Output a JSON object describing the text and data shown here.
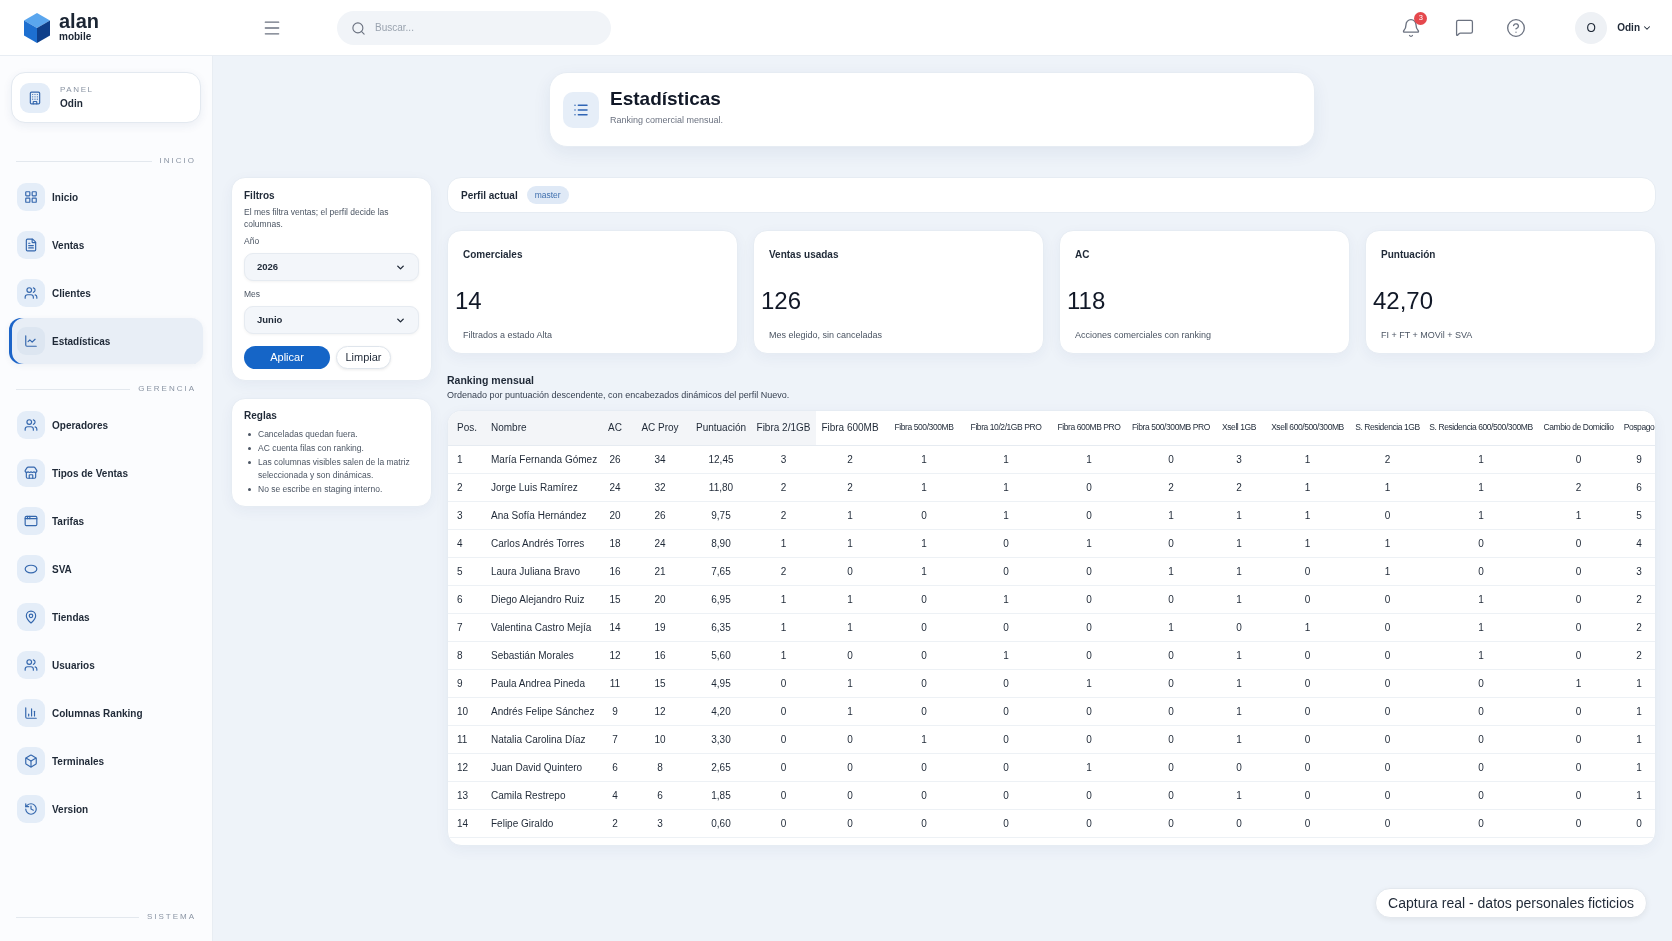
{
  "brand": {
    "name": "alan",
    "tagline": "mobile"
  },
  "search": {
    "placeholder": "Buscar..."
  },
  "notifications": {
    "count": "3"
  },
  "user": {
    "initial": "O",
    "name": "Odin"
  },
  "panel": {
    "label": "PANEL",
    "name": "Odin"
  },
  "sidebar": {
    "sections": [
      {
        "title": "INICIO",
        "items": [
          {
            "label": "Inicio",
            "selected": false
          },
          {
            "label": "Ventas",
            "selected": false
          },
          {
            "label": "Clientes",
            "selected": false
          },
          {
            "label": "Estadísticas",
            "selected": true
          }
        ]
      },
      {
        "title": "GERENCIA",
        "items": [
          {
            "label": "Operadores",
            "selected": false
          },
          {
            "label": "Tipos de Ventas",
            "selected": false
          },
          {
            "label": "Tarifas",
            "selected": false
          },
          {
            "label": "SVA",
            "selected": false
          },
          {
            "label": "Tiendas",
            "selected": false
          },
          {
            "label": "Usuarios",
            "selected": false
          },
          {
            "label": "Columnas Ranking",
            "selected": false
          },
          {
            "label": "Terminales",
            "selected": false
          },
          {
            "label": "Version",
            "selected": false
          }
        ]
      },
      {
        "title": "SISTEMA"
      }
    ]
  },
  "page_header": {
    "title": "Estadísticas",
    "subtitle": "Ranking comercial mensual."
  },
  "filters": {
    "title": "Filtros",
    "description": "El mes filtra ventas; el perfil decide las columnas.",
    "fields": [
      {
        "label": "Año",
        "value": "2026"
      },
      {
        "label": "Mes",
        "value": "Junio"
      }
    ],
    "buttons": [
      {
        "label": "Aplicar",
        "kind": "primary"
      },
      {
        "label": "Limpiar",
        "kind": "secondary"
      }
    ]
  },
  "rules": {
    "title": "Reglas",
    "items": [
      "Canceladas quedan fuera.",
      "AC cuenta filas con ranking.",
      "Las columnas visibles salen de la matriz seleccionada y son dinámicas.",
      "No se escribe en staging interno."
    ]
  },
  "profile": {
    "label": "Perfil actual",
    "badge": "master"
  },
  "stats": [
    {
      "label": "Comerciales",
      "value": "14",
      "note": "Filtrados a estado Alta"
    },
    {
      "label": "Ventas usadas",
      "value": "126",
      "note": "Mes elegido, sin canceladas"
    },
    {
      "label": "AC",
      "value": "118",
      "note": "Acciones comerciales con ranking"
    },
    {
      "label": "Puntuación",
      "value": "42,70",
      "note": "FI + FT + MOVil + SVA"
    }
  ],
  "ranking": {
    "title": "Ranking mensual",
    "subtitle": "Ordenado por puntuación descendente, con encabezados dinámicos del perfil Nuevo.",
    "columns": [
      "Pos.",
      "Nombre",
      "AC",
      "AC Proy",
      "Puntuación",
      "Fibra 2/1GB",
      "Fibra 600MB",
      "Fibra 500/300MB",
      "Fibra 10/2/1GB PRO",
      "Fibra 600MB PRO",
      "Fibra 500/300MB PRO",
      "Xsell 1GB",
      "Xsell 600/500/300MB",
      "S. Residencia 1GB",
      "S. Residencia 600/500/300MB",
      "Cambio de Domicilio",
      "Pospago"
    ],
    "rows": [
      [
        "1",
        "María Fernanda Gómez",
        "26",
        "34",
        "12,45",
        "3",
        "2",
        "1",
        "1",
        "1",
        "0",
        "3",
        "1",
        "2",
        "1",
        "0",
        "9"
      ],
      [
        "2",
        "Jorge Luis Ramírez",
        "24",
        "32",
        "11,80",
        "2",
        "2",
        "1",
        "1",
        "0",
        "2",
        "2",
        "1",
        "1",
        "1",
        "2",
        "6"
      ],
      [
        "3",
        "Ana Sofía Hernández",
        "20",
        "26",
        "9,75",
        "2",
        "1",
        "0",
        "1",
        "0",
        "1",
        "1",
        "1",
        "0",
        "1",
        "1",
        "5"
      ],
      [
        "4",
        "Carlos Andrés Torres",
        "18",
        "24",
        "8,90",
        "1",
        "1",
        "1",
        "0",
        "1",
        "0",
        "1",
        "1",
        "1",
        "0",
        "0",
        "4"
      ],
      [
        "5",
        "Laura Juliana Bravo",
        "16",
        "21",
        "7,65",
        "2",
        "0",
        "1",
        "0",
        "0",
        "1",
        "1",
        "0",
        "1",
        "0",
        "0",
        "3"
      ],
      [
        "6",
        "Diego Alejandro Ruiz",
        "15",
        "20",
        "6,95",
        "1",
        "1",
        "0",
        "1",
        "0",
        "0",
        "1",
        "0",
        "0",
        "1",
        "0",
        "2"
      ],
      [
        "7",
        "Valentina Castro Mejía",
        "14",
        "19",
        "6,35",
        "1",
        "1",
        "0",
        "0",
        "0",
        "1",
        "0",
        "1",
        "0",
        "1",
        "0",
        "2"
      ],
      [
        "8",
        "Sebastián Morales",
        "12",
        "16",
        "5,60",
        "1",
        "0",
        "0",
        "1",
        "0",
        "0",
        "1",
        "0",
        "0",
        "1",
        "0",
        "2"
      ],
      [
        "9",
        "Paula Andrea Pineda",
        "11",
        "15",
        "4,95",
        "0",
        "1",
        "0",
        "0",
        "1",
        "0",
        "1",
        "0",
        "0",
        "0",
        "1",
        "1"
      ],
      [
        "10",
        "Andrés Felipe Sánchez",
        "9",
        "12",
        "4,20",
        "0",
        "1",
        "0",
        "0",
        "0",
        "0",
        "1",
        "0",
        "0",
        "0",
        "0",
        "1"
      ],
      [
        "11",
        "Natalia Carolina Díaz",
        "7",
        "10",
        "3,30",
        "0",
        "0",
        "1",
        "0",
        "0",
        "0",
        "1",
        "0",
        "0",
        "0",
        "0",
        "1"
      ],
      [
        "12",
        "Juan David Quintero",
        "6",
        "8",
        "2,65",
        "0",
        "0",
        "0",
        "0",
        "1",
        "0",
        "0",
        "0",
        "0",
        "0",
        "0",
        "1"
      ],
      [
        "13",
        "Camila Restrepo",
        "4",
        "6",
        "1,85",
        "0",
        "0",
        "0",
        "0",
        "0",
        "0",
        "1",
        "0",
        "0",
        "0",
        "0",
        "1"
      ],
      [
        "14",
        "Felipe Giraldo",
        "2",
        "3",
        "0,60",
        "0",
        "0",
        "0",
        "0",
        "0",
        "0",
        "0",
        "0",
        "0",
        "0",
        "0",
        "0"
      ]
    ]
  },
  "caption": "Captura real - datos personales ficticios"
}
